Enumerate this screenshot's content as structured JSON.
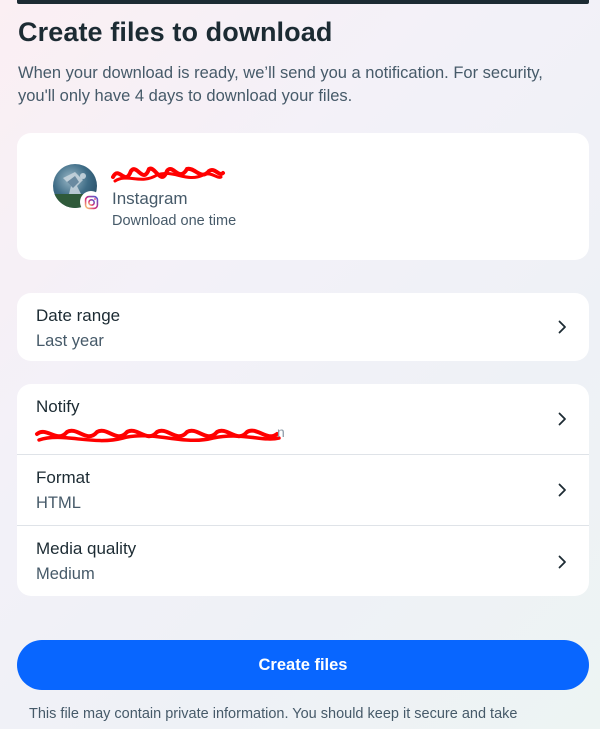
{
  "header": {
    "title": "Create files to download",
    "subtitle": "When your download is ready, we’ll send you a notification. For security, you'll only have 4 days to download your files."
  },
  "account": {
    "platform": "Instagram",
    "frequency": "Download one time",
    "badge_icon": "instagram-icon"
  },
  "date_range": {
    "label": "Date range",
    "value": "Last year"
  },
  "settings": [
    {
      "label": "Notify",
      "value": "n"
    },
    {
      "label": "Format",
      "value": "HTML"
    },
    {
      "label": "Media quality",
      "value": "Medium"
    }
  ],
  "actions": {
    "create_label": "Create files"
  },
  "footnote": "This file may contain private information. You should keep it secure and take",
  "colors": {
    "primary": "#0866ff",
    "text_primary": "#1c2b33",
    "text_secondary": "#465a69",
    "redaction": "#ff0000"
  }
}
